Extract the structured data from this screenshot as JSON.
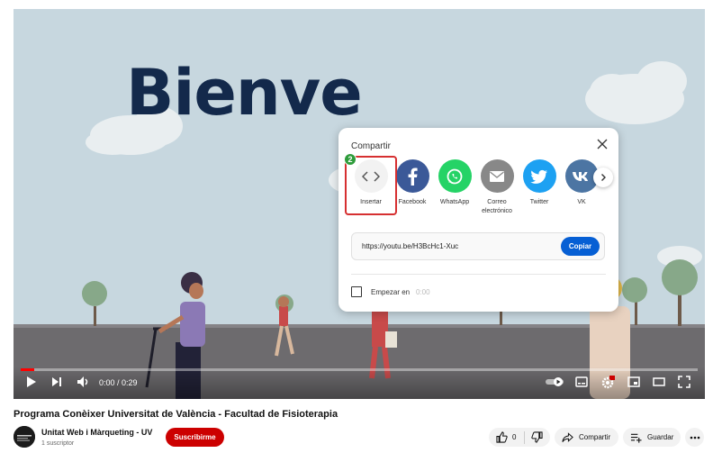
{
  "video": {
    "overlay_text": "Bienve",
    "time": "0:00 / 0:29",
    "progress_fraction": 0.02
  },
  "share": {
    "title": "Compartir",
    "step_badge": "2",
    "items": [
      {
        "label": "Insertar",
        "color": "#f2f2f2"
      },
      {
        "label": "Facebook",
        "color": "#3b5998"
      },
      {
        "label": "WhatsApp",
        "color": "#25d366"
      },
      {
        "label": "Correo electrónico",
        "color": "#888888"
      },
      {
        "label": "Twitter",
        "color": "#1da1f2"
      },
      {
        "label": "VK",
        "color": "#4c75a3"
      }
    ],
    "url": "https://youtu.be/H3BcHc1-Xuc",
    "copy_label": "Copiar",
    "start_label": "Empezar en",
    "start_time": "0:00"
  },
  "meta": {
    "title": "Programa Conèixer Universitat de València - Facultad de Fisioterapia",
    "channel": "Unitat Web i Màrqueting - UV",
    "subscribers": "1 suscriptor",
    "subscribe_label": "Suscribirme",
    "likes": "0",
    "share_label": "Compartir",
    "save_label": "Guardar"
  },
  "colors": {
    "accent": "#065fd4",
    "subscribe": "#cc0000",
    "progress": "#ff0000"
  }
}
